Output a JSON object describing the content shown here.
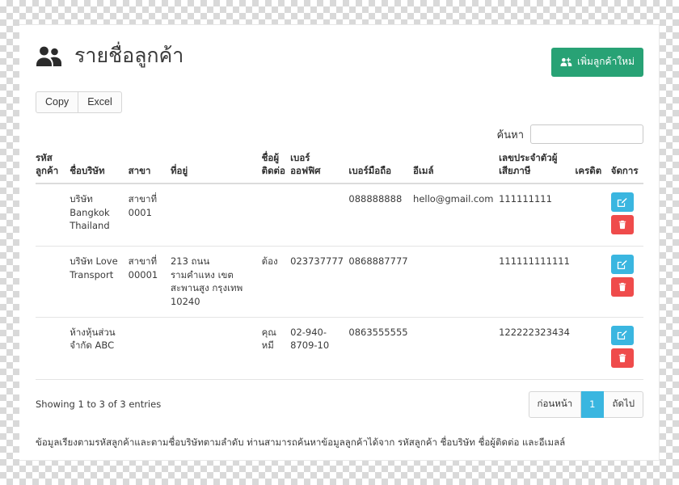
{
  "header": {
    "title": "รายชื่อลูกค้า",
    "title_icon": "users-group-icon",
    "add_button_label": "เพิ่มลูกค้าใหม่",
    "add_button_icon": "users-plus-icon",
    "accent_green": "#28a275"
  },
  "toolbar": {
    "copy_label": "Copy",
    "excel_label": "Excel"
  },
  "search": {
    "label": "ค้นหา",
    "value": "",
    "placeholder": ""
  },
  "table": {
    "columns": [
      {
        "key": "code",
        "label": "รหัส\nลูกค้า"
      },
      {
        "key": "company",
        "label": "ชื่อบริษัท"
      },
      {
        "key": "branch",
        "label": "สาขา"
      },
      {
        "key": "address",
        "label": "ที่อยู่"
      },
      {
        "key": "contact",
        "label": "ชื่อผู้\nติดต่อ"
      },
      {
        "key": "fax",
        "label": "เบอร์\nออฟฟิศ"
      },
      {
        "key": "mobile",
        "label": "เบอร์มือถือ"
      },
      {
        "key": "email",
        "label": "อีเมล์"
      },
      {
        "key": "taxid",
        "label": "เลขประจำตัวผู้\nเสียภาษี"
      },
      {
        "key": "credit",
        "label": "เครดิต"
      },
      {
        "key": "manage",
        "label": "จัดการ"
      }
    ],
    "rows": [
      {
        "code": "",
        "company": "บริษัท Bangkok Thailand",
        "branch": "สาขาที่ 0001",
        "address": "",
        "contact": "",
        "fax": "",
        "mobile": "088888888",
        "email": "hello@gmail.com",
        "taxid": "111111111",
        "credit": "",
        "actions": [
          "edit",
          "delete"
        ]
      },
      {
        "code": "",
        "company": "บริษัท Love Transport",
        "branch": "สาขาที่ 00001",
        "address": "213 ถนน รามคำแหง เขตสะพานสูง กรุงเทพ 10240",
        "contact": "ต้อง",
        "fax": "023737777",
        "mobile": "0868887777",
        "email": "",
        "taxid": "111111111111",
        "credit": "",
        "actions": [
          "edit",
          "delete"
        ]
      },
      {
        "code": "",
        "company": "ห้างหุ้นส่วน จำกัด ABC",
        "branch": "",
        "address": "",
        "contact": "คุณ หมี",
        "fax": "02-940-8709-10",
        "mobile": "0863555555",
        "email": "",
        "taxid": "122222323434",
        "credit": "",
        "actions": [
          "edit",
          "delete"
        ]
      }
    ],
    "row_action_icons": {
      "edit": "pencil-square-icon",
      "delete": "trash-icon"
    },
    "action_colors": {
      "edit": "#3ab6e0",
      "delete": "#ef4b4b"
    }
  },
  "footer": {
    "showing": "Showing 1 to 3 of 3 entries",
    "pagination": {
      "prev_label": "ก่อนหน้า",
      "pages": [
        "1"
      ],
      "active_page": "1",
      "next_label": "ถัดไป"
    },
    "note": "ข้อมูลเรียงตามรหัสลูกค้าและตามชื่อบริษัทตามลำดับ ท่านสามารถค้นหาข้อมูลลูกค้าได้จาก รหัสลูกค้า ชื่อบริษัท ชื่อผู้ติดต่อ และอีเมลล์"
  }
}
